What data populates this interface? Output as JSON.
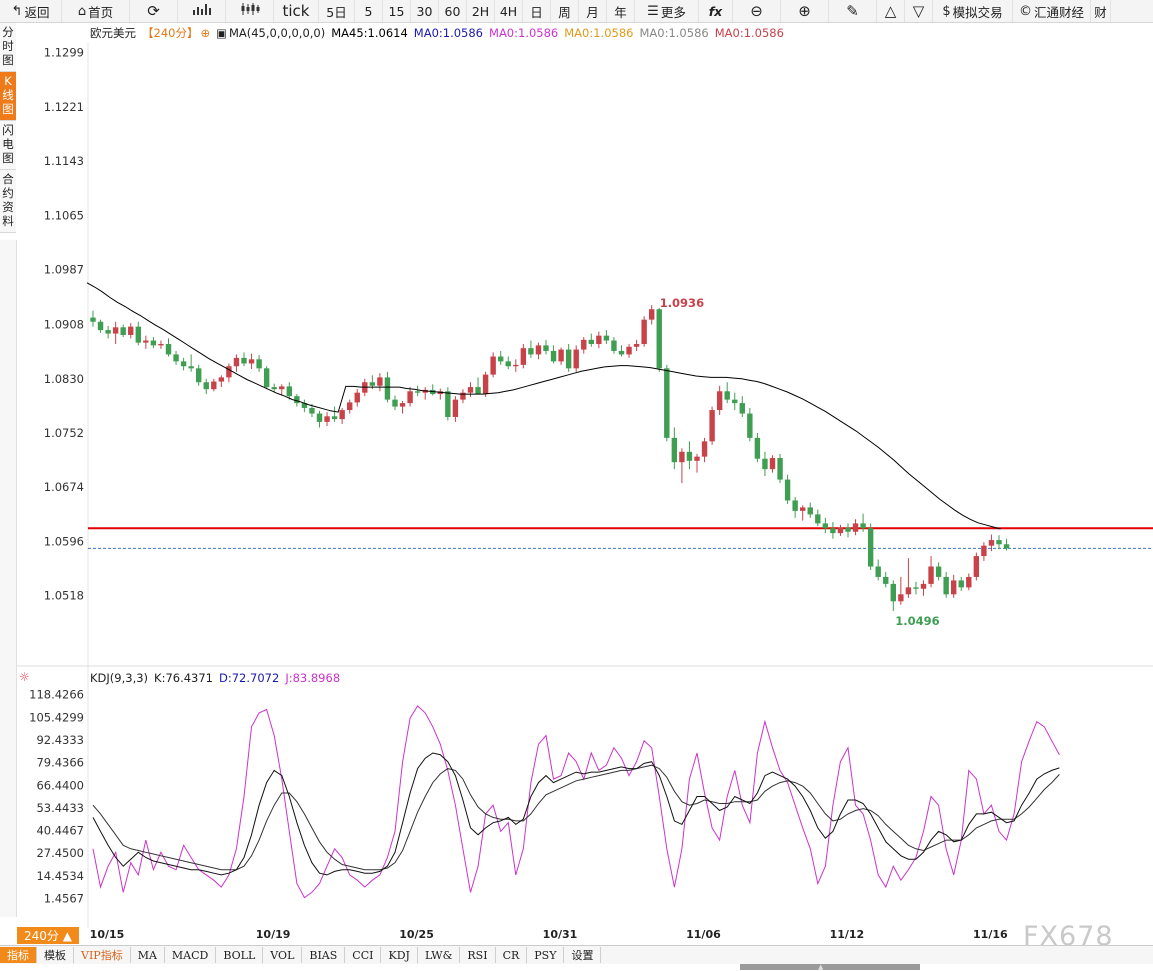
{
  "toolbar": {
    "back": "返回",
    "home": "首页",
    "tick": "tick",
    "periods": [
      "5日",
      "5",
      "15",
      "30",
      "60",
      "2H",
      "4H",
      "日",
      "周",
      "月",
      "年"
    ],
    "more": "更多",
    "fx": "fx",
    "sim_trade": "模拟交易",
    "huitong": "汇通财经",
    "truncated": "财"
  },
  "side_tabs": [
    {
      "label": "分时图",
      "active": false
    },
    {
      "label": "K线图",
      "active": true
    },
    {
      "label": "闪电图",
      "active": false
    },
    {
      "label": "合约资料",
      "active": false
    }
  ],
  "legend": {
    "symbol": "欧元美元",
    "period": "【240分】",
    "ma_label": "MA(45,0,0,0,0,0)",
    "ma45": "MA45:1.0614",
    "ma0_a": "MA0:1.0586",
    "ma0_b": "MA0:1.0586",
    "ma0_c": "MA0:1.0586",
    "ma0_d": "MA0:1.0586",
    "ma0_e": "MA0:1.0586"
  },
  "kdj_legend": {
    "name": "KDJ(9,3,3)",
    "k": "K:76.4371",
    "d": "D:72.7072",
    "j": "J:83.8968"
  },
  "period_badge": "240分 ▲",
  "bottom_tabs": [
    "指标",
    "模板",
    "VIP指标",
    "MA",
    "MACD",
    "BOLL",
    "VOL",
    "BIAS",
    "CCI",
    "KDJ",
    "LW&",
    "RSI",
    "CR",
    "PSY",
    "设置"
  ],
  "watermark": "FX678",
  "colors": {
    "up": "#c8424a",
    "down": "#3f9e52",
    "ma45": "#000000",
    "resistance": "#e00000",
    "current": "#3a78c8",
    "k_line": "#111111",
    "d_line": "#333333",
    "j_line": "#cc33cc",
    "accent": "#f28a1a"
  },
  "chart_data": {
    "type": "candlestick",
    "title": "欧元美元 240分",
    "y_ticks": [
      "1.1299",
      "1.1221",
      "1.1143",
      "1.1065",
      "1.0987",
      "1.0908",
      "1.0830",
      "1.0752",
      "1.0674",
      "1.0596",
      "1.0518"
    ],
    "y_range": [
      1.045,
      1.131
    ],
    "x_ticks": [
      "10/15",
      "10/19",
      "10/25",
      "10/31",
      "11/06",
      "11/12",
      "11/16"
    ],
    "high_annotation": "1.0936",
    "low_annotation": "1.0496",
    "resistance_level": 1.0615,
    "current_price": 1.0586,
    "candles": [
      [
        1.0918,
        1.0928,
        1.0905,
        1.0912
      ],
      [
        1.0912,
        1.0915,
        1.0896,
        1.09
      ],
      [
        1.09,
        1.0906,
        1.0888,
        1.0895
      ],
      [
        1.0895,
        1.0912,
        1.088,
        1.0904
      ],
      [
        1.0904,
        1.0908,
        1.089,
        1.0893
      ],
      [
        1.0893,
        1.091,
        1.0888,
        1.0905
      ],
      [
        1.0905,
        1.0912,
        1.0878,
        1.0882
      ],
      [
        1.0882,
        1.0892,
        1.0873,
        1.0885
      ],
      [
        1.0885,
        1.089,
        1.0874,
        1.0878
      ],
      [
        1.0878,
        1.0885,
        1.0873,
        1.088
      ],
      [
        1.088,
        1.0888,
        1.0862,
        1.0865
      ],
      [
        1.0865,
        1.087,
        1.085,
        1.0855
      ],
      [
        1.0855,
        1.086,
        1.0842,
        1.0848
      ],
      [
        1.0848,
        1.0865,
        1.084,
        1.0845
      ],
      [
        1.0845,
        1.085,
        1.082,
        1.0825
      ],
      [
        1.0825,
        1.083,
        1.0808,
        1.0815
      ],
      [
        1.0815,
        1.083,
        1.0812,
        1.0826
      ],
      [
        1.0826,
        1.0835,
        1.0818,
        1.0832
      ],
      [
        1.0832,
        1.0852,
        1.0825,
        1.0848
      ],
      [
        1.0848,
        1.0865,
        1.084,
        1.086
      ],
      [
        1.086,
        1.0868,
        1.0848,
        1.0852
      ],
      [
        1.0852,
        1.0866,
        1.0844,
        1.0858
      ],
      [
        1.0858,
        1.0864,
        1.084,
        1.0845
      ],
      [
        1.0845,
        1.0848,
        1.0815,
        1.0818
      ],
      [
        1.0818,
        1.0823,
        1.081,
        1.0815
      ],
      [
        1.0815,
        1.0822,
        1.0806,
        1.0819
      ],
      [
        1.0819,
        1.0825,
        1.08,
        1.0805
      ],
      [
        1.0805,
        1.0808,
        1.079,
        1.0795
      ],
      [
        1.0795,
        1.08,
        1.0782,
        1.0788
      ],
      [
        1.0788,
        1.0794,
        1.0775,
        1.078
      ],
      [
        1.078,
        1.0784,
        1.076,
        1.0768
      ],
      [
        1.0768,
        1.0782,
        1.0762,
        1.0776
      ],
      [
        1.0776,
        1.079,
        1.0768,
        1.0772
      ],
      [
        1.0772,
        1.0788,
        1.0765,
        1.0785
      ],
      [
        1.0785,
        1.08,
        1.078,
        1.0796
      ],
      [
        1.0796,
        1.0815,
        1.079,
        1.081
      ],
      [
        1.081,
        1.083,
        1.0805,
        1.0825
      ],
      [
        1.0825,
        1.0835,
        1.0815,
        1.082
      ],
      [
        1.082,
        1.0838,
        1.0812,
        1.0832
      ],
      [
        1.0832,
        1.084,
        1.0796,
        1.08
      ],
      [
        1.08,
        1.0806,
        1.0785,
        1.079
      ],
      [
        1.079,
        1.0798,
        1.078,
        1.0795
      ],
      [
        1.0795,
        1.0818,
        1.079,
        1.0812
      ],
      [
        1.0812,
        1.082,
        1.0805,
        1.081
      ],
      [
        1.081,
        1.0818,
        1.08,
        1.0814
      ],
      [
        1.0814,
        1.0822,
        1.0806,
        1.0808
      ],
      [
        1.0808,
        1.0816,
        1.08,
        1.0812
      ],
      [
        1.0812,
        1.0818,
        1.077,
        1.0775
      ],
      [
        1.0775,
        1.0805,
        1.0768,
        1.08
      ],
      [
        1.08,
        1.0815,
        1.0795,
        1.081
      ],
      [
        1.081,
        1.0825,
        1.0804,
        1.0818
      ],
      [
        1.0818,
        1.0832,
        1.081,
        1.0808
      ],
      [
        1.0808,
        1.084,
        1.0804,
        1.0836
      ],
      [
        1.0836,
        1.0868,
        1.0832,
        1.0862
      ],
      [
        1.0862,
        1.087,
        1.085,
        1.0855
      ],
      [
        1.0855,
        1.0862,
        1.0844,
        1.0848
      ],
      [
        1.0848,
        1.0858,
        1.084,
        1.085
      ],
      [
        1.085,
        1.088,
        1.0845,
        1.0874
      ],
      [
        1.0874,
        1.0885,
        1.086,
        1.0865
      ],
      [
        1.0865,
        1.0882,
        1.0858,
        1.0878
      ],
      [
        1.0878,
        1.0886,
        1.0865,
        1.087
      ],
      [
        1.087,
        1.0878,
        1.0852,
        1.0855
      ],
      [
        1.0855,
        1.0875,
        1.085,
        1.0872
      ],
      [
        1.0872,
        1.088,
        1.084,
        1.0845
      ],
      [
        1.0845,
        1.0878,
        1.084,
        1.0872
      ],
      [
        1.0872,
        1.089,
        1.0866,
        1.0886
      ],
      [
        1.0886,
        1.0895,
        1.0876,
        1.088
      ],
      [
        1.088,
        1.0898,
        1.0874,
        1.0892
      ],
      [
        1.0892,
        1.09,
        1.088,
        1.0885
      ],
      [
        1.0885,
        1.089,
        1.0866,
        1.087
      ],
      [
        1.087,
        1.0878,
        1.0862,
        1.0865
      ],
      [
        1.0865,
        1.088,
        1.086,
        1.0876
      ],
      [
        1.0876,
        1.0886,
        1.087,
        1.088
      ],
      [
        1.088,
        1.092,
        1.0876,
        1.0915
      ],
      [
        1.0915,
        1.0936,
        1.0908,
        1.093
      ],
      [
        1.093,
        1.0932,
        1.084,
        1.0845
      ],
      [
        1.0845,
        1.085,
        1.074,
        1.0745
      ],
      [
        1.0745,
        1.076,
        1.07,
        1.071
      ],
      [
        1.071,
        1.073,
        1.068,
        1.0725
      ],
      [
        1.0725,
        1.074,
        1.07,
        1.0712
      ],
      [
        1.0712,
        1.0722,
        1.0695,
        1.0718
      ],
      [
        1.0718,
        1.0745,
        1.071,
        1.074
      ],
      [
        1.074,
        1.079,
        1.0735,
        1.0785
      ],
      [
        1.0785,
        1.082,
        1.0778,
        1.0812
      ],
      [
        1.0812,
        1.0825,
        1.0795,
        1.08
      ],
      [
        1.08,
        1.081,
        1.0785,
        1.0795
      ],
      [
        1.0795,
        1.0805,
        1.0775,
        1.078
      ],
      [
        1.078,
        1.0788,
        1.074,
        1.0745
      ],
      [
        1.0745,
        1.0752,
        1.071,
        1.0715
      ],
      [
        1.0715,
        1.0725,
        1.069,
        1.07
      ],
      [
        1.07,
        1.072,
        1.0695,
        1.0716
      ],
      [
        1.0716,
        1.0722,
        1.068,
        1.0685
      ],
      [
        1.0685,
        1.0692,
        1.065,
        1.0655
      ],
      [
        1.0655,
        1.066,
        1.063,
        1.064
      ],
      [
        1.064,
        1.0648,
        1.0626,
        1.0645
      ],
      [
        1.0645,
        1.0652,
        1.063,
        1.0635
      ],
      [
        1.0635,
        1.0642,
        1.0618,
        1.0622
      ],
      [
        1.0622,
        1.063,
        1.0608,
        1.0615
      ],
      [
        1.0615,
        1.0624,
        1.06,
        1.0608
      ],
      [
        1.0608,
        1.062,
        1.0604,
        1.0616
      ],
      [
        1.0616,
        1.0622,
        1.0602,
        1.061
      ],
      [
        1.061,
        1.0628,
        1.0605,
        1.0622
      ],
      [
        1.0622,
        1.0636,
        1.061,
        1.0615
      ],
      [
        1.0615,
        1.0622,
        1.0555,
        1.056
      ],
      [
        1.056,
        1.057,
        1.054,
        1.0545
      ],
      [
        1.0545,
        1.0552,
        1.053,
        1.0535
      ],
      [
        1.0535,
        1.054,
        1.0496,
        1.051
      ],
      [
        1.051,
        1.0545,
        1.0505,
        1.052
      ],
      [
        1.052,
        1.0572,
        1.0515,
        1.053
      ],
      [
        1.053,
        1.0538,
        1.052,
        1.0528
      ],
      [
        1.0528,
        1.054,
        1.0518,
        1.0535
      ],
      [
        1.0535,
        1.0575,
        1.053,
        1.056
      ],
      [
        1.056,
        1.0566,
        1.054,
        1.0545
      ],
      [
        1.0545,
        1.0552,
        1.0515,
        1.052
      ],
      [
        1.052,
        1.0548,
        1.0515,
        1.054
      ],
      [
        1.054,
        1.0545,
        1.0525,
        1.053
      ],
      [
        1.053,
        1.055,
        1.0526,
        1.0545
      ],
      [
        1.0545,
        1.058,
        1.054,
        1.0575
      ],
      [
        1.0575,
        1.0595,
        1.0568,
        1.059
      ],
      [
        1.059,
        1.0606,
        1.0582,
        1.0598
      ],
      [
        1.0598,
        1.0605,
        1.0585,
        1.0592
      ],
      [
        1.0592,
        1.06,
        1.0583,
        1.0586
      ]
    ],
    "ma45": [
      1.0968,
      1.0962,
      1.0955,
      1.0947,
      1.094,
      1.0934,
      1.0927,
      1.0921,
      1.0914,
      1.0907,
      1.0901,
      1.0894,
      1.0887,
      1.088,
      1.0873,
      1.0866,
      1.0859,
      1.0853,
      1.0847,
      1.0841,
      1.0835,
      1.0829,
      1.0824,
      1.0819,
      1.0814,
      1.0809,
      1.0805,
      1.08,
      1.0797,
      1.0793,
      1.079,
      1.0787,
      1.0784,
      1.0782,
      1.0819,
      1.0819,
      1.0818,
      1.0818,
      1.0818,
      1.0818,
      1.0818,
      1.0818,
      1.0816,
      1.0815,
      1.0813,
      1.0812,
      1.0811,
      1.081,
      1.0809,
      1.0808,
      1.0808,
      1.0808,
      1.0808,
      1.0809,
      1.081,
      1.0812,
      1.0814,
      1.0817,
      1.082,
      1.0823,
      1.0826,
      1.0829,
      1.0832,
      1.0835,
      1.0838,
      1.0841,
      1.0843,
      1.0845,
      1.0847,
      1.0848,
      1.0849,
      1.0849,
      1.0848,
      1.0847,
      1.0846,
      1.0844,
      1.0842,
      1.084,
      1.0838,
      1.0836,
      1.0834,
      1.0833,
      1.0832,
      1.0832,
      1.0832,
      1.0831,
      1.083,
      1.0828,
      1.0826,
      1.0823,
      1.0819,
      1.0815,
      1.0811,
      1.0806,
      1.0801,
      1.0795,
      1.0789,
      1.0783,
      1.0776,
      1.0769,
      1.0762,
      1.0755,
      1.0747,
      1.0739,
      1.0731,
      1.0722,
      1.0713,
      1.0703,
      1.0693,
      1.0684,
      1.0675,
      1.0666,
      1.0657,
      1.0649,
      1.0641,
      1.0634,
      1.0628,
      1.0623,
      1.062,
      1.0617,
      1.0614
    ],
    "kdj": {
      "y_ticks": [
        "118.4266",
        "105.4299",
        "92.4333",
        "79.4366",
        "66.4400",
        "53.4433",
        "40.4467",
        "27.4500",
        "14.4534",
        "1.4567"
      ],
      "y_range": [
        -8,
        124
      ],
      "J": [
        30,
        8,
        20,
        28,
        5,
        22,
        15,
        35,
        18,
        28,
        20,
        18,
        32,
        25,
        18,
        15,
        12,
        8,
        15,
        30,
        60,
        100,
        108,
        110,
        95,
        70,
        40,
        10,
        2,
        5,
        10,
        20,
        30,
        25,
        15,
        12,
        8,
        12,
        15,
        25,
        40,
        80,
        105,
        112,
        108,
        100,
        90,
        75,
        55,
        30,
        5,
        20,
        50,
        55,
        40,
        45,
        15,
        30,
        68,
        90,
        95,
        70,
        72,
        85,
        80,
        70,
        85,
        75,
        78,
        88,
        82,
        72,
        80,
        92,
        88,
        60,
        30,
        8,
        30,
        70,
        85,
        62,
        42,
        35,
        60,
        75,
        55,
        45,
        85,
        103,
        88,
        75,
        68,
        55,
        42,
        30,
        10,
        20,
        55,
        80,
        88,
        55,
        50,
        35,
        15,
        8,
        20,
        12,
        18,
        25,
        40,
        60,
        55,
        30,
        15,
        35,
        75,
        70,
        50,
        55,
        40,
        35,
        50,
        80,
        92,
        103,
        100,
        92,
        83.9
      ],
      "K": [
        48,
        40,
        32,
        25,
        20,
        24,
        28,
        25,
        23,
        22,
        21,
        20,
        19,
        18,
        18,
        17,
        16,
        15,
        16,
        18,
        25,
        38,
        55,
        68,
        75,
        72,
        60,
        45,
        32,
        22,
        16,
        15,
        17,
        18,
        18,
        17,
        16,
        16,
        17,
        20,
        28,
        45,
        62,
        76,
        82,
        85,
        84,
        80,
        72,
        58,
        42,
        38,
        42,
        45,
        46,
        48,
        44,
        47,
        60,
        68,
        72,
        68,
        70,
        72,
        74,
        73,
        74,
        74,
        75,
        76,
        77,
        76,
        76,
        79,
        80,
        72,
        60,
        46,
        44,
        52,
        60,
        60,
        56,
        52,
        54,
        60,
        58,
        56,
        62,
        72,
        74,
        72,
        70,
        66,
        60,
        52,
        42,
        36,
        40,
        50,
        58,
        58,
        56,
        50,
        42,
        34,
        30,
        26,
        24,
        24,
        28,
        35,
        40,
        38,
        34,
        35,
        44,
        50,
        50,
        51,
        48,
        45,
        46,
        55,
        62,
        70,
        73,
        75,
        76.4
      ],
      "D": [
        55,
        50,
        44,
        38,
        32,
        30,
        29,
        28,
        27,
        26,
        25,
        24,
        23,
        22,
        21,
        20,
        19,
        18,
        18,
        18,
        20,
        26,
        35,
        46,
        55,
        62,
        62,
        57,
        50,
        42,
        34,
        28,
        24,
        21,
        20,
        19,
        18,
        18,
        18,
        19,
        22,
        29,
        40,
        51,
        60,
        68,
        73,
        76,
        75,
        70,
        61,
        54,
        50,
        48,
        47,
        47,
        46,
        46,
        50,
        56,
        61,
        63,
        65,
        67,
        69,
        70,
        71,
        72,
        73,
        74,
        75,
        75,
        76,
        77,
        78,
        76,
        71,
        63,
        57,
        55,
        56,
        58,
        57,
        56,
        56,
        57,
        57,
        57,
        58,
        63,
        66,
        68,
        69,
        68,
        66,
        62,
        56,
        50,
        46,
        47,
        50,
        52,
        53,
        52,
        49,
        44,
        40,
        36,
        32,
        30,
        29,
        31,
        33,
        35,
        35,
        35,
        38,
        42,
        44,
        46,
        47,
        47,
        47,
        50,
        54,
        59,
        64,
        68,
        72.7
      ]
    }
  }
}
